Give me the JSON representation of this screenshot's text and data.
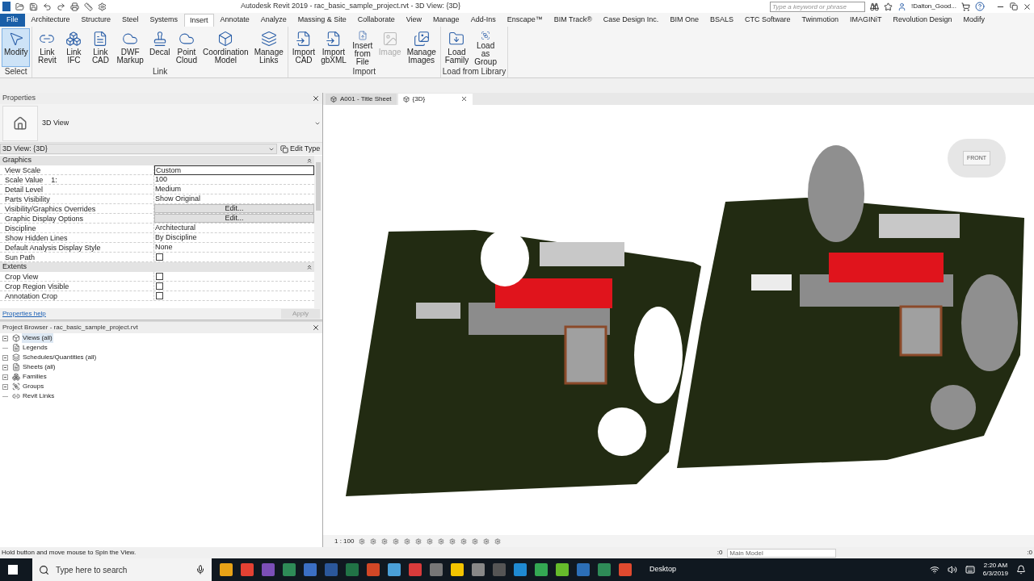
{
  "title_bar": {
    "title": "Autodesk Revit 2019 - rac_basic_sample_project.rvt - 3D View: {3D}",
    "search": {
      "placeholder": "Type a keyword or phrase"
    },
    "user": "!Dalton_Good..."
  },
  "ribbon_tabs": [
    {
      "label": "File",
      "kind": "file",
      "selected": false
    },
    {
      "label": "Architecture",
      "kind": "tab",
      "selected": false
    },
    {
      "label": "Structure",
      "kind": "tab",
      "selected": false
    },
    {
      "label": "Steel",
      "kind": "tab",
      "selected": false
    },
    {
      "label": "Systems",
      "kind": "tab",
      "selected": false
    },
    {
      "label": "Insert",
      "kind": "tab",
      "selected": true
    },
    {
      "label": "Annotate",
      "kind": "tab",
      "selected": false
    },
    {
      "label": "Analyze",
      "kind": "tab",
      "selected": false
    },
    {
      "label": "Massing & Site",
      "kind": "tab",
      "selected": false
    },
    {
      "label": "Collaborate",
      "kind": "tab",
      "selected": false
    },
    {
      "label": "View",
      "kind": "tab",
      "selected": false
    },
    {
      "label": "Manage",
      "kind": "tab",
      "selected": false
    },
    {
      "label": "Add-Ins",
      "kind": "tab",
      "selected": false
    },
    {
      "label": "Enscape™",
      "kind": "tab",
      "selected": false
    },
    {
      "label": "BIM Track®",
      "kind": "tab",
      "selected": false
    },
    {
      "label": "Case Design Inc.",
      "kind": "tab",
      "selected": false
    },
    {
      "label": "BIM One",
      "kind": "tab",
      "selected": false
    },
    {
      "label": "BSALS",
      "kind": "tab",
      "selected": false
    },
    {
      "label": "CTC Software",
      "kind": "tab",
      "selected": false
    },
    {
      "label": "Twinmotion",
      "kind": "tab",
      "selected": false
    },
    {
      "label": "IMAGINiT",
      "kind": "tab",
      "selected": false
    },
    {
      "label": "Revolution Design",
      "kind": "tab",
      "selected": false
    },
    {
      "label": "Modify",
      "kind": "tab",
      "selected": false
    }
  ],
  "ribbon_panels": [
    {
      "label": "Select",
      "tools": [
        {
          "label": "Modify",
          "selected": true,
          "disabled": false
        }
      ]
    },
    {
      "label": "Link",
      "tools": [
        {
          "label": "Link Revit",
          "selected": false,
          "disabled": false
        },
        {
          "label": "Link IFC",
          "selected": false,
          "disabled": false
        },
        {
          "label": "Link CAD",
          "selected": false,
          "disabled": false
        },
        {
          "label": "DWF Markup",
          "selected": false,
          "disabled": false
        },
        {
          "label": "Decal",
          "selected": false,
          "disabled": false
        },
        {
          "label": "Point Cloud",
          "selected": false,
          "disabled": false
        },
        {
          "label": "Coordination Model",
          "selected": false,
          "disabled": false
        },
        {
          "label": "Manage Links",
          "selected": false,
          "disabled": false
        }
      ]
    },
    {
      "label": "Import",
      "tools": [
        {
          "label": "Import CAD",
          "selected": false,
          "disabled": false
        },
        {
          "label": "Import gbXML",
          "selected": false,
          "disabled": false
        },
        {
          "label": "Insert from File",
          "selected": false,
          "disabled": false
        },
        {
          "label": "Image",
          "selected": false,
          "disabled": true
        },
        {
          "label": "Manage Images",
          "selected": false,
          "disabled": false
        }
      ]
    },
    {
      "label": "Load from Library",
      "tools": [
        {
          "label": "Load Family",
          "selected": false,
          "disabled": false
        },
        {
          "label": "Load as Group",
          "selected": false,
          "disabled": false
        }
      ]
    }
  ],
  "properties": {
    "title": "Properties",
    "type_name": "3D View",
    "type_selector": "3D View: {3D}",
    "edit_type": "Edit Type",
    "groups": [
      {
        "name": "Graphics",
        "rows": [
          {
            "label": "View Scale",
            "kind": "field",
            "value": "Custom"
          },
          {
            "label": "Scale Value    1:",
            "kind": "text",
            "value": "100"
          },
          {
            "label": "Detail Level",
            "kind": "text",
            "value": "Medium"
          },
          {
            "label": "Parts Visibility",
            "kind": "text",
            "value": "Show Original"
          },
          {
            "label": "Visibility/Graphics Overrides",
            "kind": "button",
            "value": "Edit..."
          },
          {
            "label": "Graphic Display Options",
            "kind": "button",
            "value": "Edit..."
          },
          {
            "label": "Discipline",
            "kind": "text",
            "value": "Architectural"
          },
          {
            "label": "Show Hidden Lines",
            "kind": "text",
            "value": "By Discipline"
          },
          {
            "label": "Default Analysis Display Style",
            "kind": "text",
            "value": "None"
          },
          {
            "label": "Sun Path",
            "kind": "checkbox",
            "checked": false
          }
        ]
      },
      {
        "name": "Extents",
        "rows": [
          {
            "label": "Crop View",
            "kind": "checkbox",
            "checked": false
          },
          {
            "label": "Crop Region Visible",
            "kind": "checkbox",
            "checked": false
          },
          {
            "label": "Annotation Crop",
            "kind": "checkbox",
            "checked": false
          }
        ]
      }
    ],
    "help": "Properties help",
    "apply": {
      "label": "Apply",
      "disabled": true
    }
  },
  "project_browser": {
    "title": "Project Browser - rac_basic_sample_project.rvt",
    "items": [
      {
        "label": "Views (all)",
        "expandable": true,
        "selected": true
      },
      {
        "label": "Legends",
        "expandable": false,
        "selected": false
      },
      {
        "label": "Schedules/Quantities (all)",
        "expandable": true,
        "selected": false
      },
      {
        "label": "Sheets (all)",
        "expandable": true,
        "selected": false
      },
      {
        "label": "Families",
        "expandable": true,
        "selected": false
      },
      {
        "label": "Groups",
        "expandable": true,
        "selected": false
      },
      {
        "label": "Revit Links",
        "expandable": false,
        "selected": false
      }
    ]
  },
  "view_tabs": [
    {
      "label": "A001 - Title Sheet",
      "selected": false
    },
    {
      "label": "{3D}",
      "selected": true
    }
  ],
  "view_cube": {
    "face": "FRONT"
  },
  "view_control_bar": {
    "scale": "1 : 100"
  },
  "status_bar": {
    "message": "Hold button and move mouse to Spin the View.",
    "count": ":0",
    "workset": "Main Model",
    "filter_count": ":0"
  },
  "taskbar": {
    "search_placeholder": "Type here to search",
    "toolbar": "Desktop",
    "time": "2:20 AM",
    "date": "6/3/2019"
  }
}
